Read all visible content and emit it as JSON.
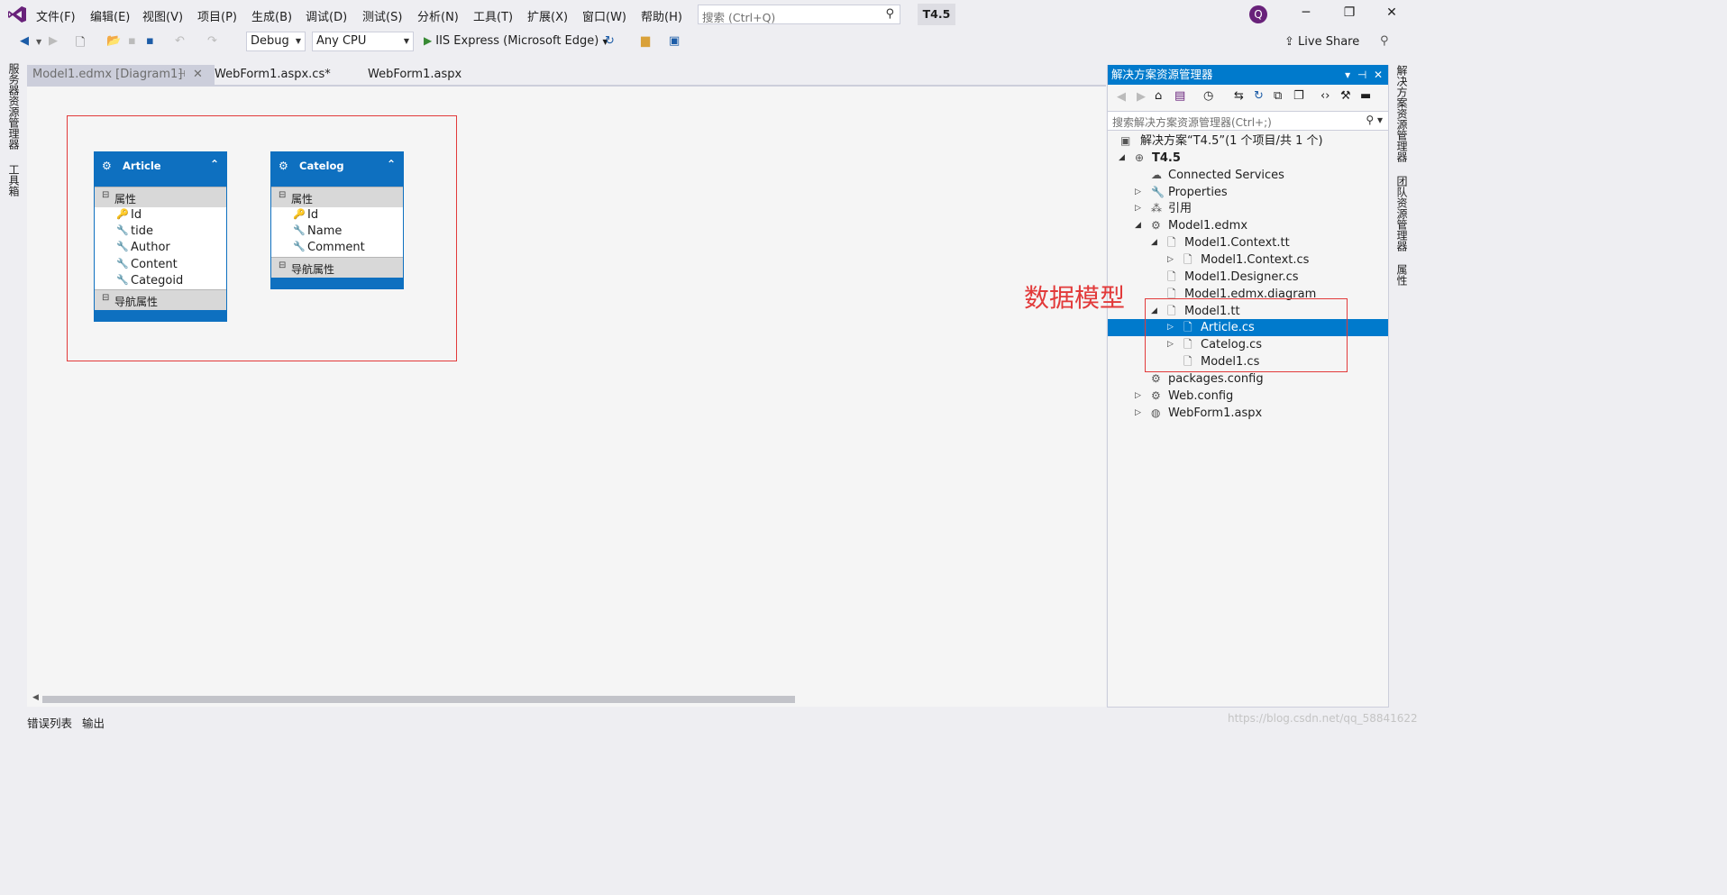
{
  "menubar": {
    "items": [
      "文件(F)",
      "编辑(E)",
      "视图(V)",
      "项目(P)",
      "生成(B)",
      "调试(D)",
      "测试(S)",
      "分析(N)",
      "工具(T)",
      "扩展(X)",
      "窗口(W)",
      "帮助(H)"
    ],
    "search_placeholder": "搜索 (Ctrl+Q)",
    "project_title": "T4.5",
    "avatar_letter": "Q"
  },
  "toolbar": {
    "config": "Debug",
    "platform": "Any CPU",
    "run_target": "IIS Express (Microsoft Edge)",
    "live_share": "Live Share"
  },
  "left_strip": {
    "server_explorer": "服务器资源管理器",
    "toolbox": "工具箱"
  },
  "tabs": [
    {
      "label": "Model1.edmx [Diagram1]",
      "active": false
    },
    {
      "label": "WebForm1.aspx.cs*",
      "active": false
    },
    {
      "label": "WebForm1.aspx",
      "active": false
    }
  ],
  "diagram": {
    "entities": [
      {
        "name": "Article",
        "section_props": "属性",
        "properties": [
          {
            "name": "Id",
            "key": true
          },
          {
            "name": "tide",
            "key": false
          },
          {
            "name": "Author",
            "key": false
          },
          {
            "name": "Content",
            "key": false
          },
          {
            "name": "Categoid",
            "key": false
          }
        ],
        "section_nav": "导航属性"
      },
      {
        "name": "Catelog",
        "section_props": "属性",
        "properties": [
          {
            "name": "Id",
            "key": true
          },
          {
            "name": "Name",
            "key": false
          },
          {
            "name": "Comment",
            "key": false
          }
        ],
        "section_nav": "导航属性"
      }
    ]
  },
  "bottom_tabs": [
    "错误列表",
    "输出"
  ],
  "solution_explorer": {
    "title": "解决方案资源管理器",
    "search_placeholder": "搜索解决方案资源管理器(Ctrl+;)",
    "tree": [
      {
        "label": "解决方案“T4.5”(1 个项目/共 1 个)",
        "depth": 0,
        "expander": "",
        "icon": "solution-icon"
      },
      {
        "label": "T4.5",
        "depth": 0,
        "expander": "◢",
        "icon": "web-project-icon",
        "bold": true
      },
      {
        "label": "Connected Services",
        "depth": 1,
        "expander": "",
        "icon": "connected-services-icon"
      },
      {
        "label": "Properties",
        "depth": 1,
        "expander": "▷",
        "icon": "wrench-icon"
      },
      {
        "label": "引用",
        "depth": 1,
        "expander": "▷",
        "icon": "references-icon"
      },
      {
        "label": "Model1.edmx",
        "depth": 1,
        "expander": "◢",
        "icon": "edmx-icon"
      },
      {
        "label": "Model1.Context.tt",
        "depth": 2,
        "expander": "◢",
        "icon": "file-icon"
      },
      {
        "label": "Model1.Context.cs",
        "depth": 3,
        "expander": "▷",
        "icon": "cs-file-icon"
      },
      {
        "label": "Model1.Designer.cs",
        "depth": 2,
        "expander": "",
        "icon": "cs-file-icon"
      },
      {
        "label": "Model1.edmx.diagram",
        "depth": 2,
        "expander": "",
        "icon": "file-icon"
      },
      {
        "label": "Model1.tt",
        "depth": 2,
        "expander": "◢",
        "icon": "file-icon"
      },
      {
        "label": "Article.cs",
        "depth": 3,
        "expander": "▷",
        "icon": "cs-file-icon",
        "selected": true
      },
      {
        "label": "Catelog.cs",
        "depth": 3,
        "expander": "▷",
        "icon": "cs-file-icon"
      },
      {
        "label": "Model1.cs",
        "depth": 3,
        "expander": "",
        "icon": "cs-file-icon"
      },
      {
        "label": "packages.config",
        "depth": 1,
        "expander": "",
        "icon": "config-icon"
      },
      {
        "label": "Web.config",
        "depth": 1,
        "expander": "▷",
        "icon": "config-icon"
      },
      {
        "label": "WebForm1.aspx",
        "depth": 1,
        "expander": "▷",
        "icon": "aspx-icon"
      }
    ]
  },
  "right_strip": {
    "solution_explorer": "解决方案资源管理器",
    "team_explorer": "团队资源管理器",
    "properties": "属性"
  },
  "annotation": "数据模型",
  "watermark": "https://blog.csdn.net/qq_58841622"
}
